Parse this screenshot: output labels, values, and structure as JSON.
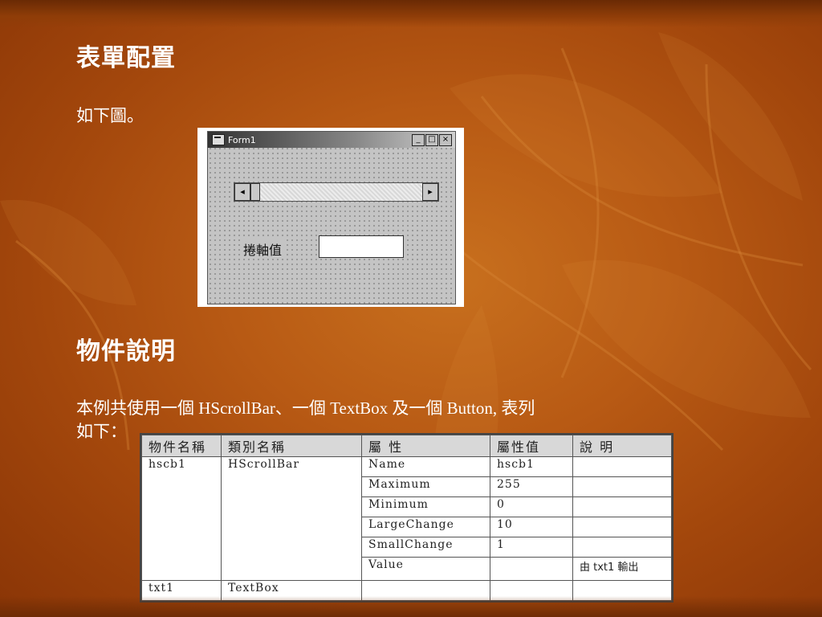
{
  "heading1": "表單配置",
  "intro": "如下圖。",
  "form": {
    "title": "Form1",
    "minimize": "_",
    "maximize": "□",
    "close": "×",
    "scroll_left": "◂",
    "scroll_right": "▸",
    "label": "捲軸值"
  },
  "heading2": "物件說明",
  "description_line1": "本例共使用一個 HScrollBar、一個 TextBox 及一個 Button, 表列",
  "description_line2": "如下：",
  "table": {
    "headers": [
      "物件名稱",
      "類別名稱",
      "屬 性",
      "屬性值",
      "說 明"
    ],
    "rows": [
      [
        "hscb1",
        "HScrollBar",
        "Name",
        "hscb1",
        ""
      ],
      [
        "",
        "",
        "Maximum",
        "255",
        ""
      ],
      [
        "",
        "",
        "Minimum",
        "0",
        ""
      ],
      [
        "",
        "",
        "LargeChange",
        "10",
        ""
      ],
      [
        "",
        "",
        "SmallChange",
        "1",
        ""
      ],
      [
        "",
        "",
        "Value",
        "",
        "由 txt1 輸出"
      ],
      [
        "txt1",
        "TextBox",
        "",
        "",
        ""
      ]
    ]
  },
  "colors": {
    "background": "#b85a14",
    "text": "#ffffff"
  }
}
